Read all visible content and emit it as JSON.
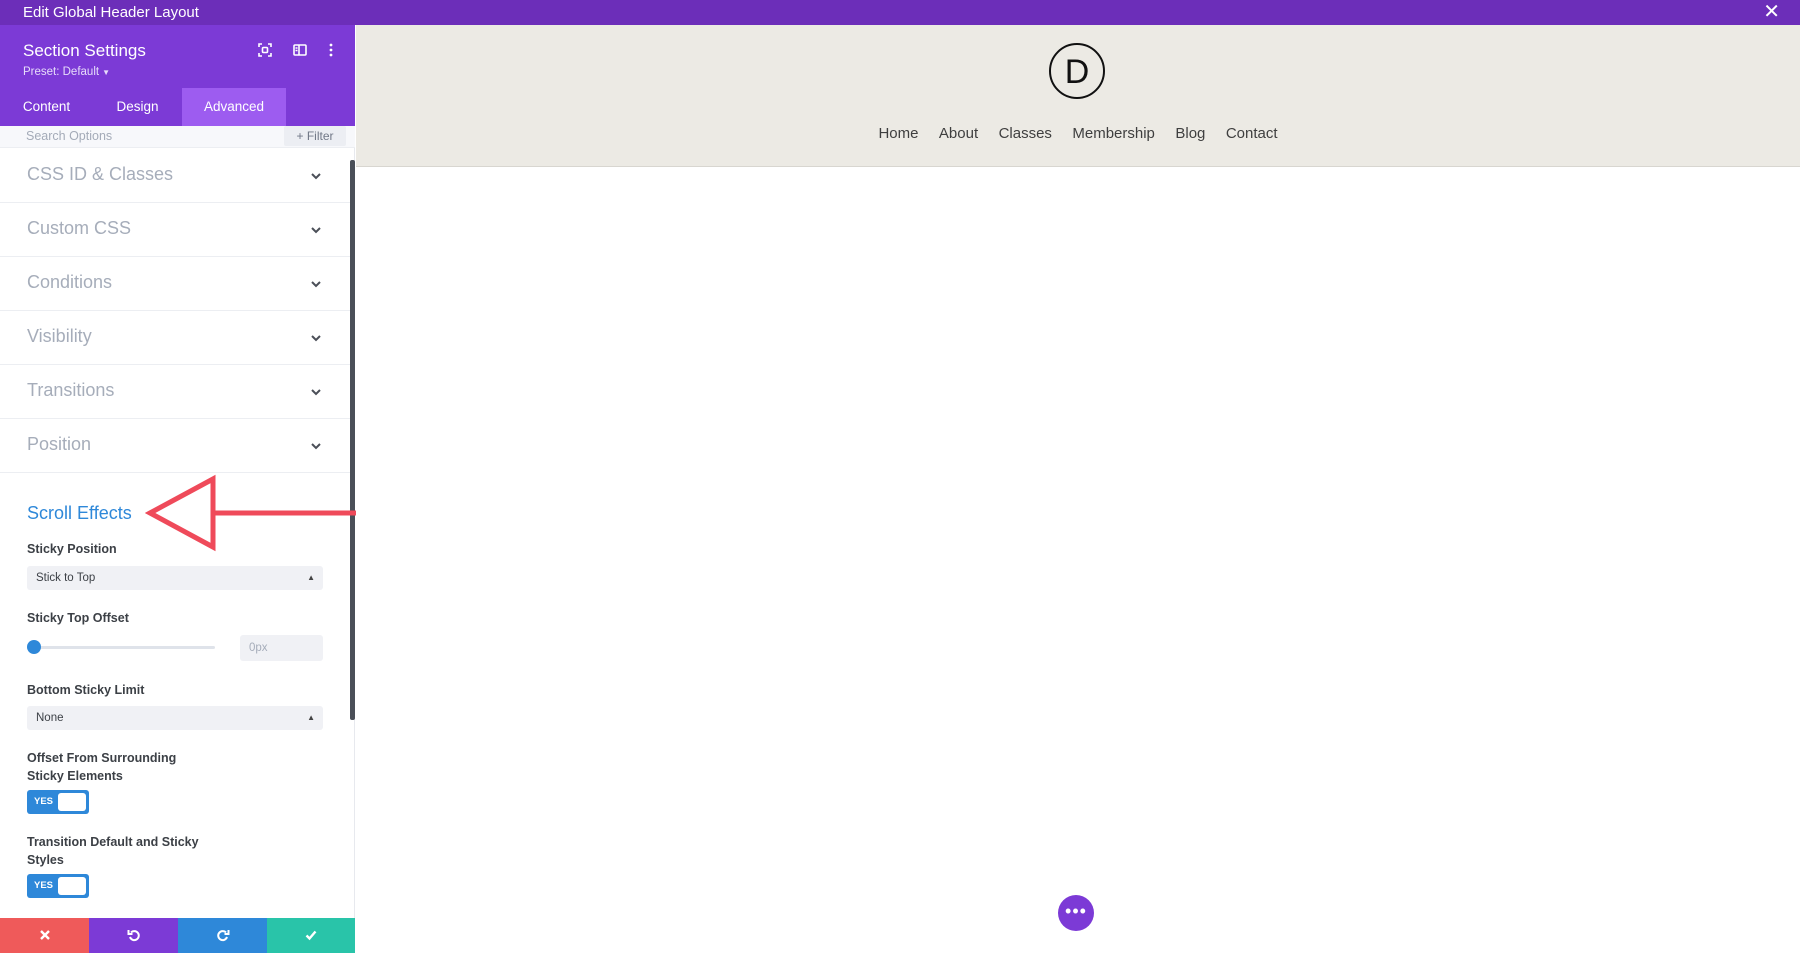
{
  "topbar": {
    "title": "Edit Global Header Layout",
    "close_icon": "close-icon"
  },
  "panel": {
    "title": "Section Settings",
    "preset_label": "Preset: Default",
    "tabs": [
      {
        "label": "Content"
      },
      {
        "label": "Design"
      },
      {
        "label": "Advanced"
      }
    ],
    "active_tab": "Advanced",
    "search_placeholder": "Search Options",
    "filter_label": "+ Filter",
    "accordions": [
      {
        "label": "CSS ID & Classes"
      },
      {
        "label": "Custom CSS"
      },
      {
        "label": "Conditions"
      },
      {
        "label": "Visibility"
      },
      {
        "label": "Transitions"
      },
      {
        "label": "Position"
      }
    ],
    "scroll_effects": {
      "title": "Scroll Effects",
      "sticky_position_label": "Sticky Position",
      "sticky_position_value": "Stick to Top",
      "sticky_top_offset_label": "Sticky Top Offset",
      "sticky_top_offset_placeholder": "0px",
      "sticky_top_offset_value": 0,
      "bottom_sticky_limit_label": "Bottom Sticky Limit",
      "bottom_sticky_limit_value": "None",
      "offset_surrounding_label_1": "Offset From Surrounding",
      "offset_surrounding_label_2": "Sticky Elements",
      "offset_surrounding_toggle": "YES",
      "transition_label_1": "Transition Default and Sticky",
      "transition_label_2": "Styles",
      "transition_toggle": "YES"
    }
  },
  "preview": {
    "logo_letter": "D",
    "nav": [
      "Home",
      "About",
      "Classes",
      "Membership",
      "Blog",
      "Contact"
    ]
  },
  "colors": {
    "brand_purple": "#7c3ad6",
    "topbar_purple": "#6c2eb9",
    "accent_blue": "#2e88d9",
    "cancel_red": "#ef5a5a",
    "save_green": "#29c4a9",
    "annotation_red": "#ef4a5a"
  }
}
